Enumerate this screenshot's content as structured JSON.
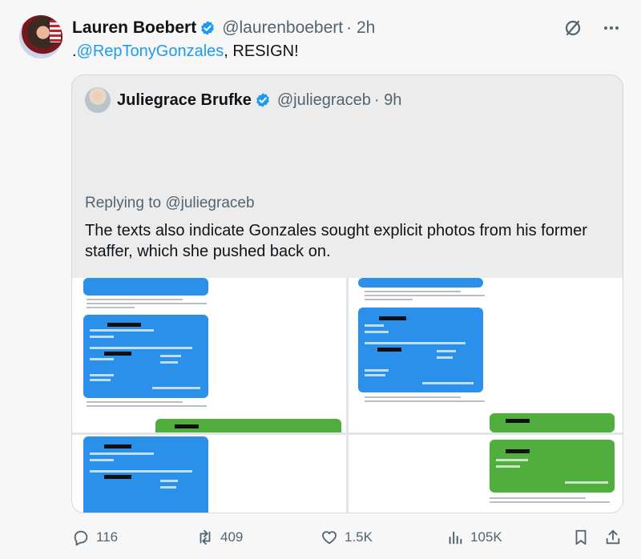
{
  "tweet": {
    "author_name": "Lauren Boebert",
    "author_handle": "@laurenboebert",
    "time": "· 2h",
    "text_prefix": ".",
    "mention": "@RepTonyGonzales",
    "text_suffix": ", RESIGN!"
  },
  "quote": {
    "author_name": "Juliegrace Brufke",
    "author_handle": "@juliegraceb",
    "time": "· 9h",
    "replying_label": "Replying to",
    "replying_handle": "@juliegraceb",
    "body": "The texts also indicate Gonzales sought explicit photos from his former staffer, which she pushed back on."
  },
  "actions": {
    "replies": "116",
    "reposts": "409",
    "likes": "1.5K",
    "views": "105K"
  },
  "icons": {
    "top": [
      "grok-slash-icon",
      "more-dots-icon"
    ],
    "bottom": [
      "reply-icon",
      "repost-icon",
      "like-icon",
      "views-icon",
      "bookmark-icon",
      "share-icon"
    ]
  },
  "colors": {
    "accent": "#1d9bf0",
    "muted": "#536471",
    "imessage_blue": "#2a90ea",
    "sms_green": "#4fae3c"
  }
}
